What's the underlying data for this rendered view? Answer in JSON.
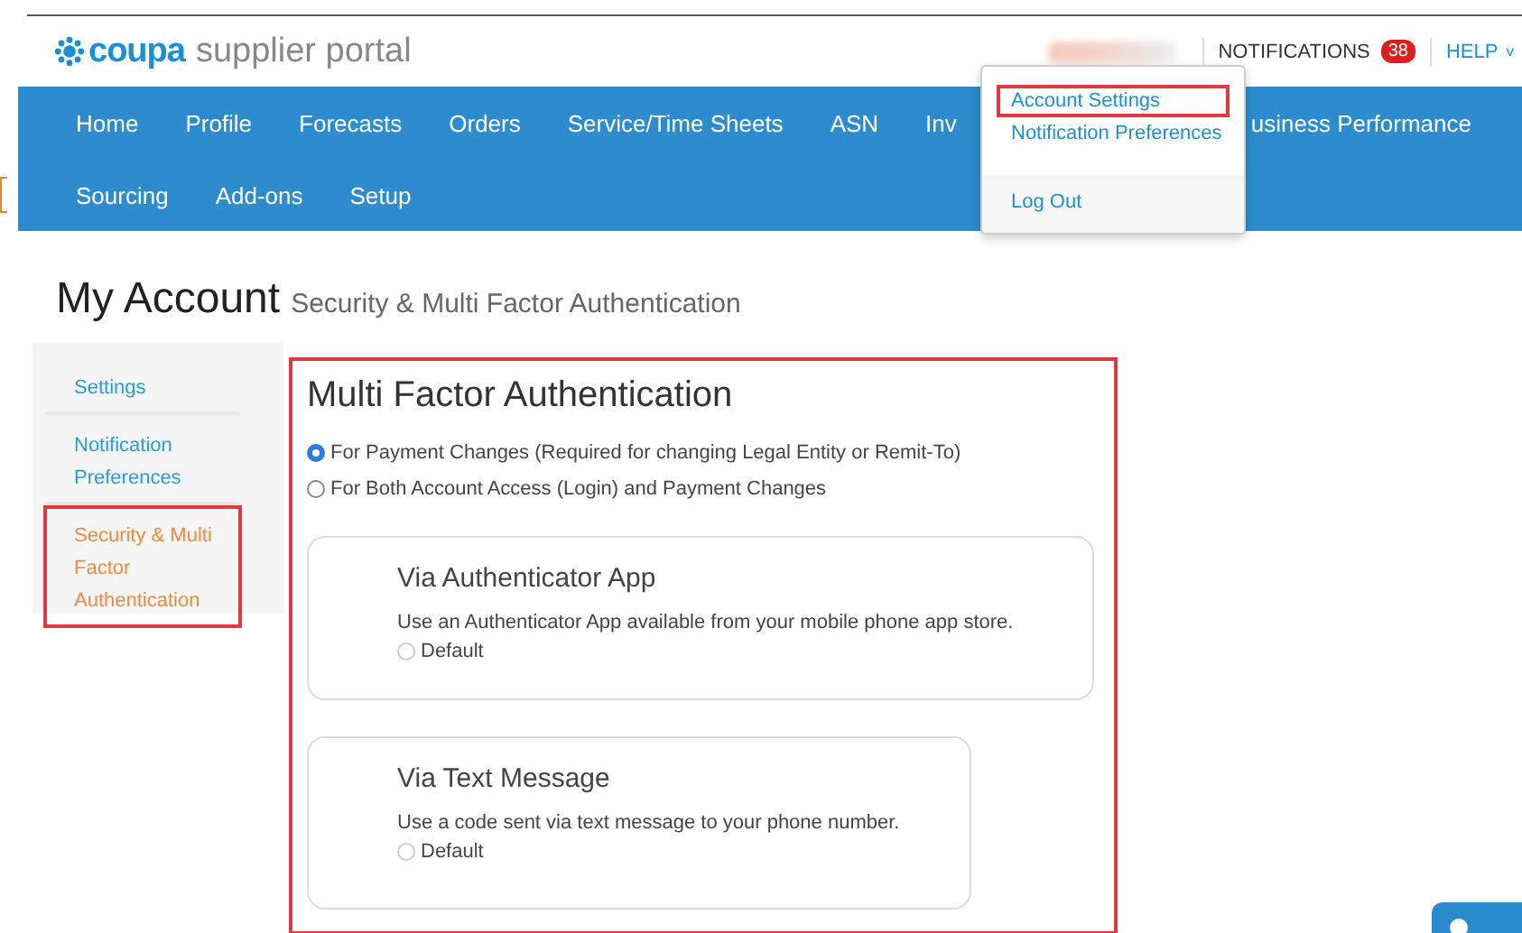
{
  "header": {
    "logo_brand": "coupa",
    "logo_product": "supplier portal",
    "notifications": {
      "label": "NOTIFICATIONS",
      "count": "38"
    },
    "help": {
      "label": "HELP",
      "caret": "˅"
    }
  },
  "user_menu": {
    "items": [
      {
        "label": "Account Settings",
        "highlighted": true
      },
      {
        "label": "Notification Preferences",
        "highlighted": false
      }
    ],
    "footer": "Log Out"
  },
  "nav": {
    "row_1": [
      "Home",
      "Profile",
      "Forecasts",
      "Orders",
      "Service/Time Sheets",
      "ASN",
      "Inv"
    ],
    "row_1_after_menu": [
      "usiness Performance"
    ],
    "row_2": [
      "Sourcing",
      "Add-ons",
      "Setup"
    ]
  },
  "page": {
    "title": "My Account",
    "subtitle": "Security & Multi Factor Authentication"
  },
  "sidebar": {
    "items": [
      {
        "label": "Settings",
        "selected": false,
        "highlighted": false
      },
      {
        "label": "Notification Preferences",
        "selected": false,
        "highlighted": false
      },
      {
        "label": "Security & Multi Factor Authentication",
        "selected": true,
        "highlighted": true
      }
    ]
  },
  "panel": {
    "highlighted": true,
    "title": "Multi Factor Authentication",
    "scope_options": [
      {
        "label": "For Payment Changes (Required for changing Legal Entity or Remit-To)",
        "selected": true
      },
      {
        "label": "For Both Account Access (Login) and Payment Changes",
        "selected": false
      }
    ],
    "methods": [
      {
        "title": "Via Authenticator App",
        "description": "Use an Authenticator App available from your mobile phone app store.",
        "option": {
          "label": "Default",
          "selected": false
        }
      },
      {
        "title": "Via Text Message",
        "description": "Use a code sent via text message to your phone number.",
        "option": {
          "label": "Default",
          "selected": false
        }
      }
    ]
  }
}
